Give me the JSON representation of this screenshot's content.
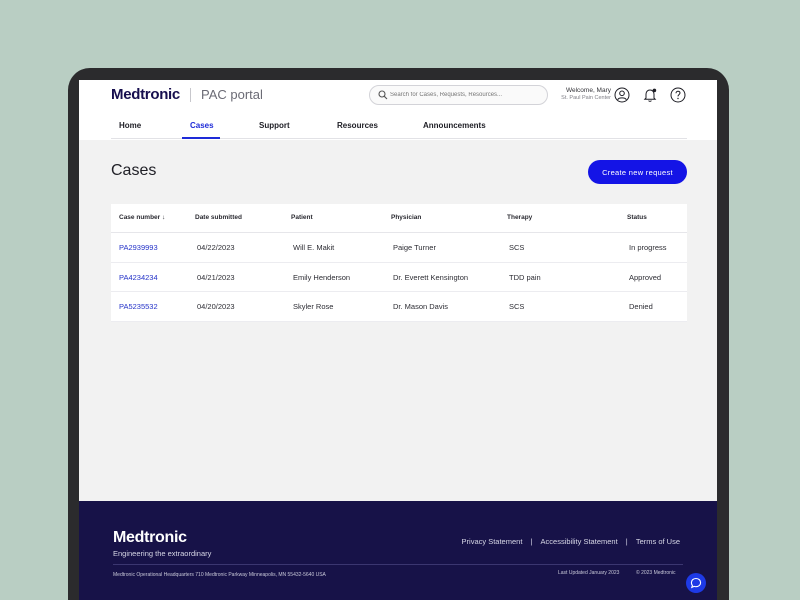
{
  "header": {
    "logo": "Medtronic",
    "portal_name": "PAC portal",
    "search_placeholder": "Search for Cases, Requests, Resources...",
    "welcome": "Welcome, Mary",
    "location": "St. Paul Pain Center",
    "icons": [
      "search-icon",
      "user-icon",
      "notification-bell-icon",
      "help-icon"
    ]
  },
  "nav": {
    "items": [
      {
        "label": "Home"
      },
      {
        "label": "Cases"
      },
      {
        "label": "Support"
      },
      {
        "label": "Resources"
      },
      {
        "label": "Announcements"
      }
    ],
    "active": "Cases"
  },
  "main": {
    "title": "Cases",
    "create_button": "Create new request"
  },
  "table": {
    "columns": [
      "Case number ↓",
      "Date submitted",
      "Patient",
      "Physician",
      "Therapy",
      "Status"
    ],
    "rows": [
      {
        "case": "PA2939993",
        "date": "04/22/2023",
        "patient": "Will E. Makit",
        "physician": "Paige Turner",
        "therapy": "SCS",
        "status": "In progress"
      },
      {
        "case": "PA4234234",
        "date": "04/21/2023",
        "patient": "Emily Henderson",
        "physician": "Dr. Everett Kensington",
        "therapy": "TDD pain",
        "status": "Approved"
      },
      {
        "case": "PA5235532",
        "date": "04/20/2023",
        "patient": "Skyler Rose",
        "physician": "Dr. Mason Davis",
        "therapy": "SCS",
        "status": "Denied"
      }
    ]
  },
  "footer": {
    "logo": "Medtronic",
    "tagline": "Engineering the extraordinary",
    "links": [
      "Privacy Statement",
      "Accessibility Statement",
      "Terms of Use"
    ],
    "address": "Medtronic Operational Headquarters  710 Medtronic Parkway Minneapolis, MN 55432-5640 USA",
    "updated": "Last Updated January 2023",
    "copyright": "© 2023 Medtronic"
  },
  "colors": {
    "accent": "#1414e6",
    "link": "#2432c8",
    "footer_bg": "#171248",
    "background": "#b9cec3"
  }
}
